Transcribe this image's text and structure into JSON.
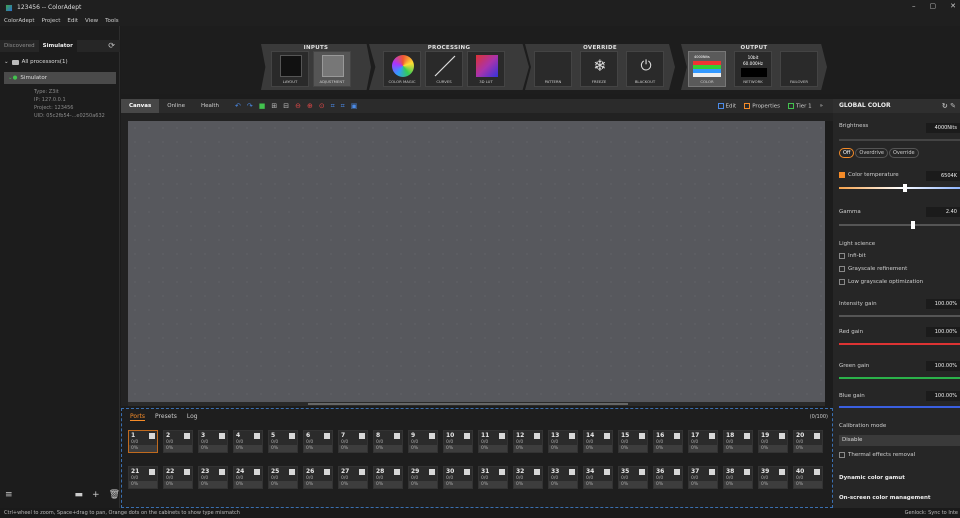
{
  "window": {
    "title": "123456 -- ColorAdept",
    "controls": [
      "–",
      "▢",
      "✕"
    ]
  },
  "menu": [
    "ColorAdept",
    "Project",
    "Edit",
    "View",
    "Tools"
  ],
  "left": {
    "tabs": [
      "Discovered",
      "Simulator"
    ],
    "tree": {
      "root": "All processors(1)",
      "selected": "Simulator"
    },
    "info": [
      "Type: Z3it",
      "IP: 127.0.0.1",
      "Project: 123456",
      "UID: 05c2fb54-...e0250a632"
    ]
  },
  "groups": {
    "inputs": {
      "label": "INPUTS",
      "buttons": [
        "LAYOUT",
        "ADJUSTMENT"
      ]
    },
    "processing": {
      "label": "PROCESSING",
      "buttons": [
        "COLOR MAGIC",
        "CURVES",
        "3D LUT"
      ]
    },
    "override": {
      "label": "OVERRIDE",
      "buttons": [
        "PATTERN",
        "FREEZE",
        "BLACKOUT"
      ]
    },
    "output": {
      "label": "OUTPUT",
      "buttons": [
        "COLOR",
        "NETWORK",
        "FAILOVER"
      ],
      "color_nits": "4000Nits",
      "network_bit": "10bit",
      "network_hz": "60.000Hz"
    }
  },
  "canvas_toolbar": {
    "tabs": [
      "Canvas",
      "Online",
      "Health"
    ],
    "edit": "Edit",
    "properties": "Properties",
    "tier": "Tier 1",
    "more": "»"
  },
  "ports": {
    "tabs": [
      "Ports",
      "Presets",
      "Log"
    ],
    "count": "(0/100)",
    "ratio": "0/0",
    "pct": "0%",
    "row1": [
      "1",
      "2",
      "3",
      "4",
      "5",
      "6",
      "7",
      "8",
      "9",
      "10",
      "11",
      "12",
      "13",
      "14",
      "15",
      "16",
      "17",
      "18",
      "19",
      "20"
    ],
    "row2": [
      "21",
      "22",
      "23",
      "24",
      "25",
      "26",
      "27",
      "28",
      "29",
      "30",
      "31",
      "32",
      "33",
      "34",
      "35",
      "36",
      "37",
      "38",
      "39",
      "40"
    ]
  },
  "right": {
    "title": "GLOBAL COLOR",
    "brightness": {
      "label": "Brightness",
      "value": "4000Nits"
    },
    "modes": [
      "Off",
      "Overdrive",
      "Override"
    ],
    "color_temp": {
      "label": "Color temperature",
      "value": "6504K"
    },
    "gamma": {
      "label": "Gamma",
      "value": "2.40"
    },
    "light_science": {
      "label": "Light science",
      "items": [
        "Infi-bit",
        "Grayscale refinement",
        "Low grayscale optimization"
      ]
    },
    "intensity": {
      "label": "Intensity gain",
      "value": "100.00%"
    },
    "red": {
      "label": "Red gain",
      "value": "100.00%"
    },
    "green": {
      "label": "Green gain",
      "value": "100.00%"
    },
    "blue": {
      "label": "Blue gain",
      "value": "100.00%"
    },
    "calibration": {
      "label": "Calibration mode",
      "value": "Disable"
    },
    "thermal": "Thermal effects removal",
    "dynamic": "Dynamic color gamut",
    "onscreen": "On-screen color management"
  },
  "status": {
    "left": "Ctrl+wheel to zoom, Space+drag to pan, Orange dots on the cabinets to show type mismatch",
    "right": "Genlock: Sync to Inte"
  }
}
